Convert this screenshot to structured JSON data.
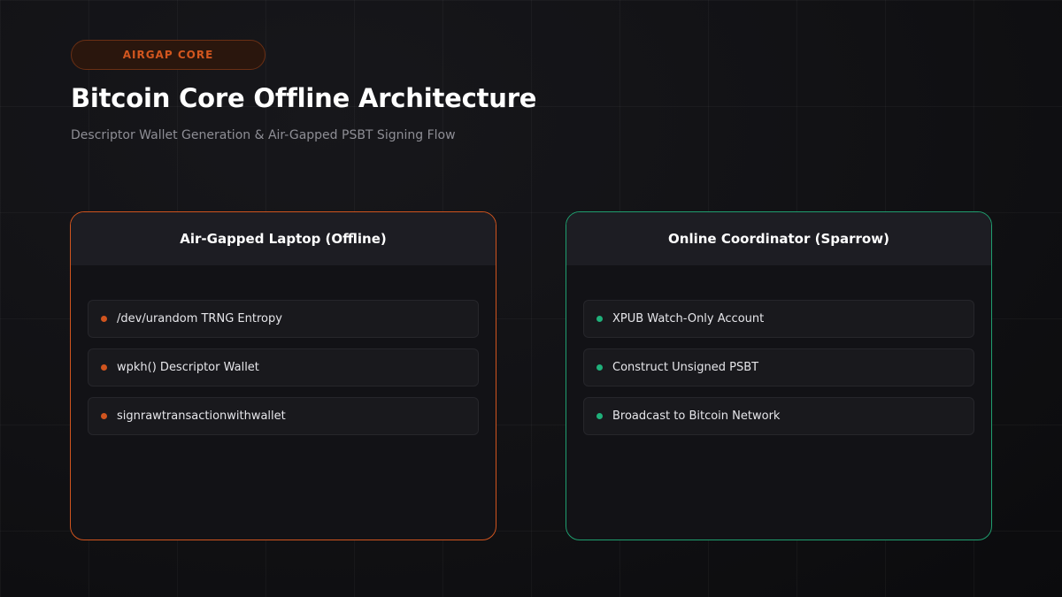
{
  "badge": "AIRGAP CORE",
  "title": "Bitcoin Core Offline Architecture",
  "subtitle": "Descriptor Wallet Generation & Air-Gapped PSBT Signing Flow",
  "colors": {
    "offline_accent": "#d0541e",
    "online_accent": "#1fb07a"
  },
  "offline_panel": {
    "title": "Air-Gapped Laptop (Offline)",
    "items": [
      "/dev/urandom TRNG Entropy",
      "wpkh() Descriptor Wallet",
      "signrawtransactionwithwallet"
    ]
  },
  "online_panel": {
    "title": "Online Coordinator (Sparrow)",
    "items": [
      "XPUB Watch-Only Account",
      "Construct Unsigned PSBT",
      "Broadcast to Bitcoin Network"
    ]
  }
}
